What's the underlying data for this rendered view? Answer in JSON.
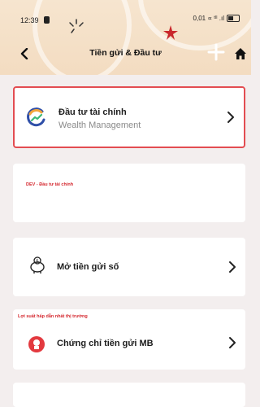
{
  "status_bar": {
    "time": "12:39",
    "right_text": "0,01 ∝ ᵗˡˡ .ıl"
  },
  "nav": {
    "title": "Tiền gửi & Đầu tư"
  },
  "cards": {
    "investment": {
      "title": "Đầu tư tài chính",
      "subtitle": "Wealth Management"
    },
    "dev_tag": "DEV - Đầu tư tài chính",
    "savings": {
      "title": "Mở tiền gửi số"
    },
    "cd_tag": "Lợi suất hấp dẫn nhất thị trường",
    "certificate": {
      "title": "Chứng chỉ tiền gửi MB"
    }
  },
  "colors": {
    "accent": "#e34d52",
    "header_bg": "#f4dfc6",
    "page_bg": "#f3eeee"
  }
}
